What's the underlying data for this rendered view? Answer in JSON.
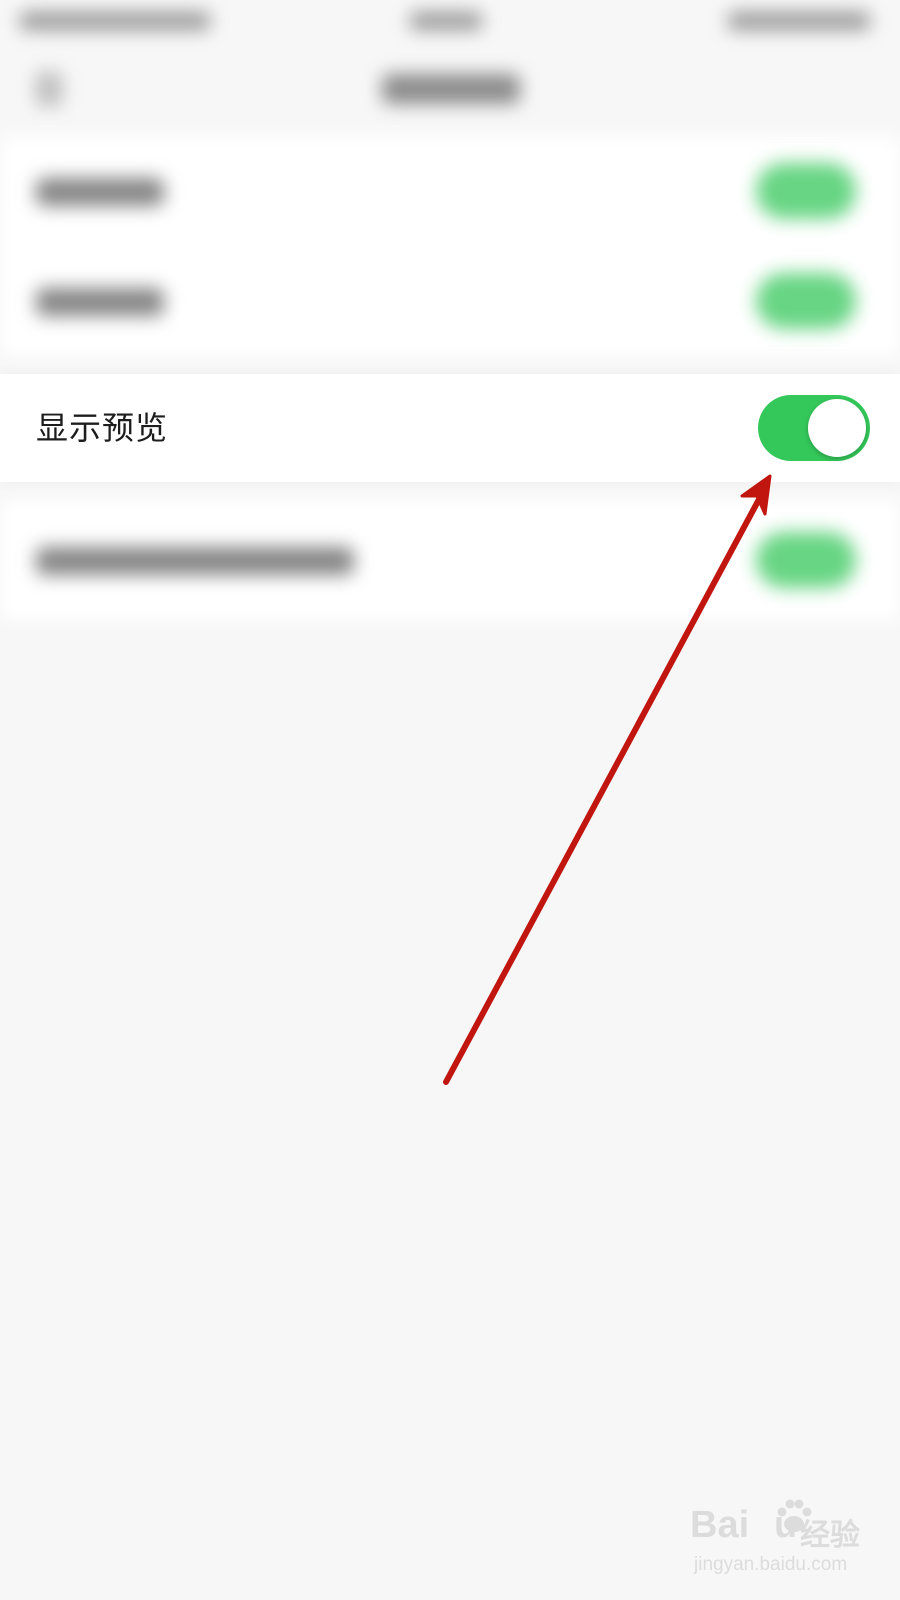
{
  "settings": {
    "preview_row": {
      "label": "显示预览",
      "toggle_on": true
    }
  },
  "watermark": {
    "brand_latin_left": "Bai",
    "brand_latin_right": "u",
    "brand_cn": "经验",
    "url": "jingyan.baidu.com"
  },
  "colors": {
    "toggle_on": "#34c759",
    "annotation_arrow": "#c0160f",
    "background": "#f7f7f7",
    "row_background": "#ffffff"
  },
  "icons": [
    "back-arrow-icon",
    "annotation-arrow-icon",
    "baidu-paw-icon"
  ]
}
